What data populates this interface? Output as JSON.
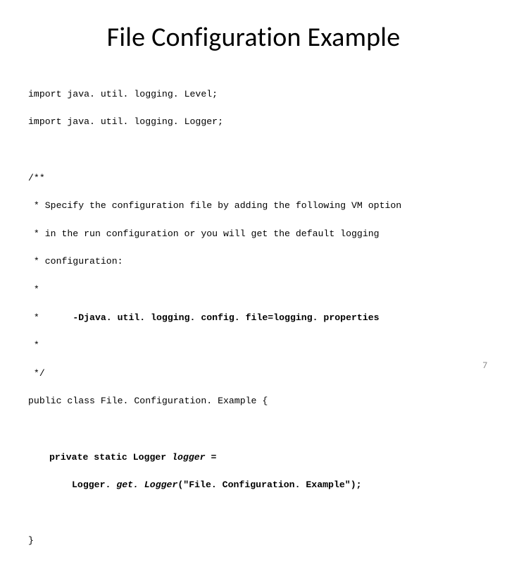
{
  "title": "File Configuration Example",
  "code": {
    "import1": "import java. util. logging. Level;",
    "import2": "import java. util. logging. Logger;",
    "doc0": "/**",
    "doc1": " * Specify the configuration file by adding the following VM option",
    "doc2": " * in the run configuration or you will get the default logging",
    "doc3": " * configuration:",
    "doc4": " *",
    "doc5_pre": " *      ",
    "doc5_bold": "-Djava. util. logging. config. file=logging. properties",
    "doc6": " *",
    "doc7": " */",
    "classdecl": "public class File. Configuration. Example {",
    "field_pre": "private static Logger ",
    "field_var": "logger ",
    "field_post": "=",
    "getlogger_pre": "Logger. ",
    "getlogger_call": "get. Logger",
    "getlogger_args": "(\"File. Configuration. Example\");",
    "close": "}"
  },
  "page_number": "7"
}
